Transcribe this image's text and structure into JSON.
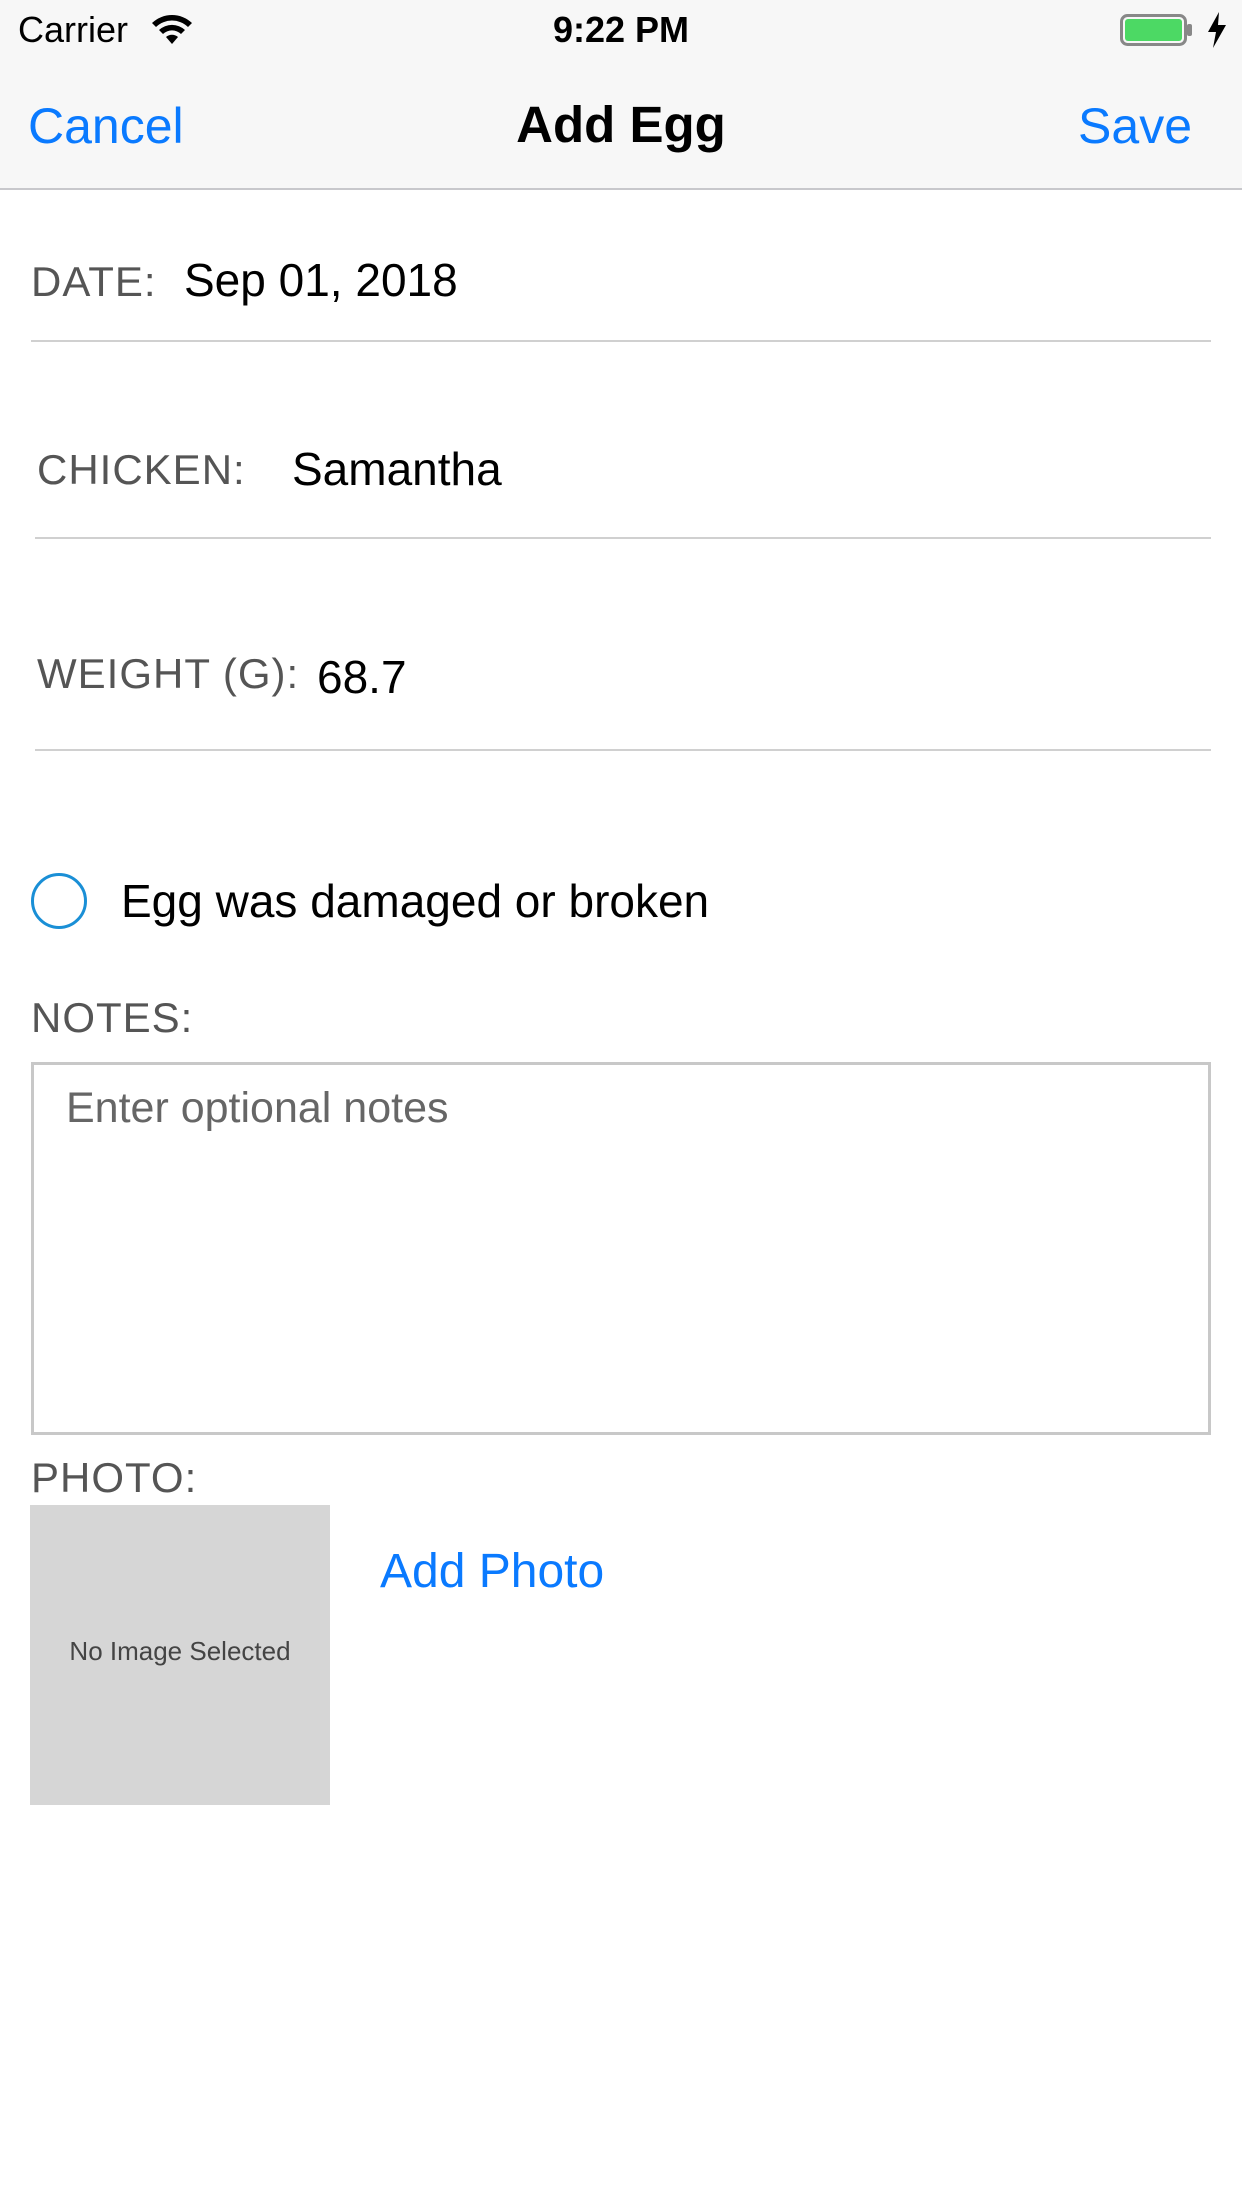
{
  "status_bar": {
    "carrier": "Carrier",
    "time": "9:22 PM",
    "icons": [
      "wifi-icon",
      "battery-icon",
      "charging-bolt-icon"
    ],
    "battery_color": "#4cd964"
  },
  "nav": {
    "cancel_label": "Cancel",
    "title": "Add Egg",
    "save_label": "Save",
    "accent_color": "#0a7aff"
  },
  "form": {
    "date": {
      "label": "DATE:",
      "value": "Sep 01, 2018"
    },
    "chicken": {
      "label": "CHICKEN:",
      "value": "Samantha"
    },
    "weight": {
      "label": "WEIGHT (G):",
      "value": "68.7"
    },
    "damaged": {
      "label": "Egg was damaged or broken",
      "checked": false
    },
    "notes": {
      "label": "NOTES:",
      "placeholder": "Enter optional notes",
      "value": ""
    },
    "photo": {
      "label": "PHOTO:",
      "empty_text": "No Image Selected",
      "add_label": "Add Photo"
    }
  }
}
